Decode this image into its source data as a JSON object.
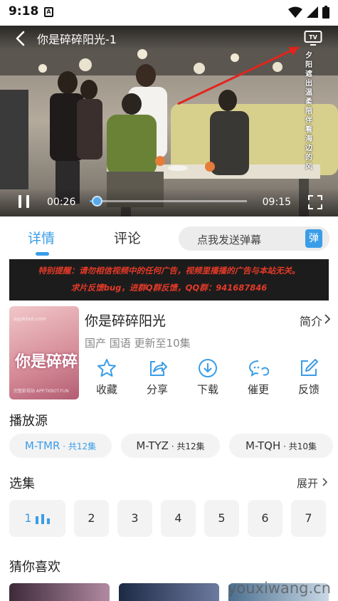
{
  "status_bar": {
    "time": "9:18",
    "notification_icon": "A"
  },
  "player": {
    "title": "你是碎碎阳光-1",
    "current_time": "00:26",
    "total_time": "09:15",
    "progress_fraction": 0.047,
    "overlay_vertical_text": "夕阳遮出温柔陪伴看海边的风"
  },
  "tabs": {
    "details": "详情",
    "comments": "评论",
    "active": "details"
  },
  "danmu": {
    "placeholder": "点我发送弹幕",
    "button": "弹"
  },
  "banner": {
    "line1": "特别提醒：请勿相信视频中的任何广告，视频里播播的广告与本站无关。",
    "line2": "求片反馈bug，进群Q群反馈，QQ群：941687846"
  },
  "poster": {
    "art_title": "你是碎碎",
    "watermark_top": "appkbot.com",
    "watermark_bottom": "完整影视站 APP.TKBOT.FUN"
  },
  "show": {
    "title": "你是碎碎阳光",
    "intro_label": "简介",
    "meta": "国产 国语 更新至10集"
  },
  "actions": [
    {
      "label": "收藏",
      "icon": "star-icon"
    },
    {
      "label": "分享",
      "icon": "share-icon"
    },
    {
      "label": "下载",
      "icon": "download-icon"
    },
    {
      "label": "催更",
      "icon": "chat-refresh-icon"
    },
    {
      "label": "反馈",
      "icon": "edit-icon"
    }
  ],
  "sources": {
    "title": "播放源",
    "items": [
      {
        "name": "M-TMR",
        "count": " · 共12集",
        "active": true
      },
      {
        "name": "M-TYZ",
        "count": " · 共12集",
        "active": false
      },
      {
        "name": "M-TQH",
        "count": " · 共10集",
        "active": false
      }
    ]
  },
  "episodes": {
    "title": "选集",
    "expand_label": "展开",
    "items": [
      "1",
      "2",
      "3",
      "4",
      "5",
      "6",
      "7"
    ],
    "active_index": 0
  },
  "recommend": {
    "title": "猜你喜欢"
  },
  "watermark": "youxiwang.cn",
  "colors": {
    "accent": "#3a9de8",
    "banner_bg": "#1c1c1c",
    "banner_text": "#e63a28"
  }
}
